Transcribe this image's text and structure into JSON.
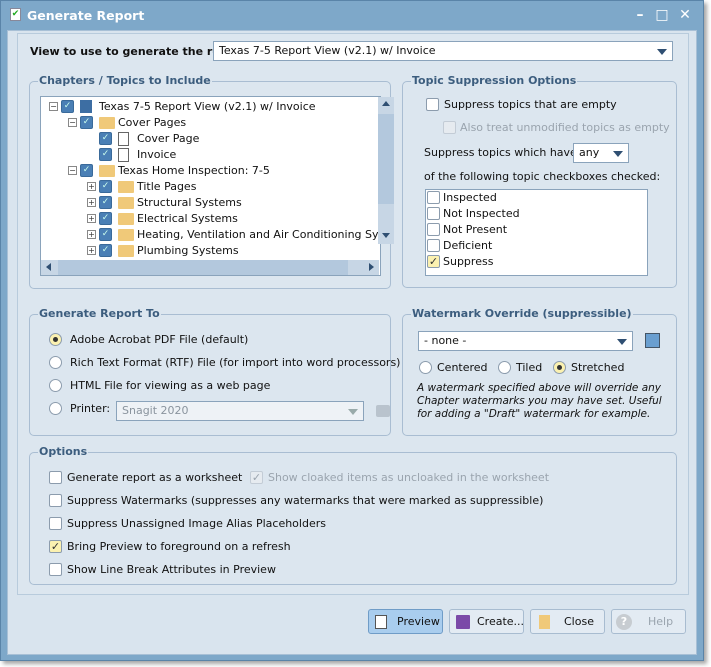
{
  "window": {
    "title": "Generate Report",
    "icon": "report-check-icon"
  },
  "view": {
    "label": "View to use to generate the report:",
    "value": "Texas 7-5 Report View (v2.1) w/ Invoice"
  },
  "chapters": {
    "title": "Chapters / Topics to Include",
    "tree": [
      {
        "label": "Texas 7-5 Report View (v2.1) w/ Invoice",
        "level": 0,
        "icon": "report-view-icon",
        "expander": "minus"
      },
      {
        "label": "Cover Pages",
        "level": 1,
        "icon": "folder-open-icon",
        "expander": "minus"
      },
      {
        "label": "Cover Page",
        "level": 2,
        "icon": "document-icon",
        "expander": ""
      },
      {
        "label": "Invoice",
        "level": 2,
        "icon": "document-icon",
        "expander": ""
      },
      {
        "label": "Texas Home Inspection: 7-5",
        "level": 1,
        "icon": "folder-open-icon",
        "expander": "minus"
      },
      {
        "label": "Title Pages",
        "level": 2,
        "icon": "folder-icon",
        "expander": "plus"
      },
      {
        "label": "Structural Systems",
        "level": 2,
        "icon": "folder-icon",
        "expander": "plus"
      },
      {
        "label": "Electrical Systems",
        "level": 2,
        "icon": "folder-icon",
        "expander": "plus"
      },
      {
        "label": "Heating, Ventilation and Air Conditioning Syste",
        "level": 2,
        "icon": "folder-icon",
        "expander": "plus"
      },
      {
        "label": "Plumbing Systems",
        "level": 2,
        "icon": "folder-icon",
        "expander": "plus"
      }
    ]
  },
  "suppression": {
    "title": "Topic Suppression Options",
    "empty_label": "Suppress topics that are empty",
    "empty_checked": false,
    "unmodified_label": "Also treat unmodified topics as empty",
    "unmodified_checked": false,
    "which_label": "Suppress topics which have",
    "which_value": "any",
    "following_label": "of the following topic checkboxes checked:",
    "checkboxes": [
      {
        "label": "Inspected",
        "checked": false
      },
      {
        "label": "Not Inspected",
        "checked": false
      },
      {
        "label": "Not Present",
        "checked": false
      },
      {
        "label": "Deficient",
        "checked": false
      },
      {
        "label": "Suppress",
        "checked": true
      }
    ]
  },
  "generate_to": {
    "title": "Generate Report To",
    "options": [
      {
        "label": "Adobe Acrobat PDF File (default)",
        "selected": true
      },
      {
        "label": "Rich Text Format (RTF) File (for import into word processors)",
        "selected": false
      },
      {
        "label": "HTML File for viewing as a web page",
        "selected": false
      },
      {
        "label": "Printer:",
        "selected": false
      }
    ],
    "printer_value": "Snagit 2020"
  },
  "watermark": {
    "title": "Watermark Override (suppressible)",
    "value": "- none -",
    "modes": [
      {
        "label": "Centered",
        "selected": false
      },
      {
        "label": "Tiled",
        "selected": false
      },
      {
        "label": "Stretched",
        "selected": true
      }
    ],
    "note": "A watermark specified above will override any Chapter watermarks you may have set.  Useful for adding a \"Draft\" watermark for example."
  },
  "options": {
    "title": "Options",
    "items": [
      {
        "label": "Generate report as a worksheet",
        "checked": false
      },
      {
        "label": "Show cloaked items as uncloaked in the worksheet",
        "checked": true,
        "disabled": true
      },
      {
        "label": "Suppress Watermarks (suppresses any watermarks that were marked as suppressible)",
        "checked": false
      },
      {
        "label": "Suppress Unassigned Image Alias Placeholders",
        "checked": false
      },
      {
        "label": "Bring Preview to foreground on a refresh",
        "checked": true
      },
      {
        "label": "Show Line Break Attributes in Preview",
        "checked": false
      }
    ]
  },
  "buttons": {
    "preview": "Preview",
    "create": "Create...",
    "close": "Close",
    "help": "Help"
  }
}
